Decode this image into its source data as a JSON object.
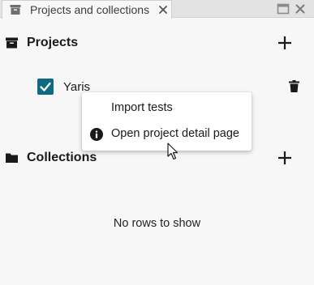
{
  "tab": {
    "title": "Projects and collections",
    "icon": "archive-box-icon",
    "close_icon": "close-icon"
  },
  "window_controls": [
    "maximize-icon",
    "close-window-icon"
  ],
  "projects": {
    "title": "Projects",
    "icon": "archive-box-icon",
    "add_icon": "plus-icon",
    "items": [
      {
        "name": "Yaris",
        "checked": true,
        "delete_icon": "trash-icon"
      }
    ]
  },
  "context_menu": {
    "items": [
      {
        "label": "Import tests",
        "icon": ""
      },
      {
        "label": "Open project detail page",
        "icon": "info-icon"
      }
    ]
  },
  "collections": {
    "title": "Collections",
    "icon": "folder-icon",
    "add_icon": "plus-icon",
    "empty_message": "No rows to show"
  },
  "colors": {
    "accent": "#0e6a83",
    "background": "#f7f7f7",
    "tabbar": "#e3e3e3"
  }
}
